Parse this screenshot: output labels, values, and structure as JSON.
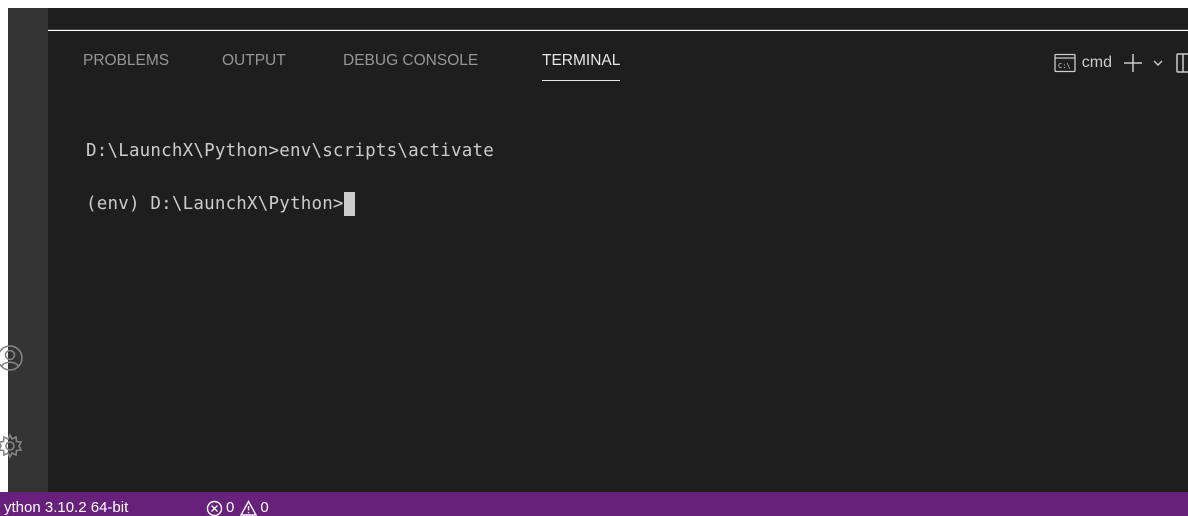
{
  "panel": {
    "tabs": [
      {
        "label": "PROBLEMS"
      },
      {
        "label": "OUTPUT"
      },
      {
        "label": "DEBUG CONSOLE"
      },
      {
        "label": "TERMINAL"
      }
    ],
    "active_tab": "TERMINAL",
    "terminal_name": "cmd"
  },
  "terminal": {
    "lines": [
      "D:\\LaunchX\\Python>env\\scripts\\activate",
      "(env) D:\\LaunchX\\Python>"
    ]
  },
  "status_bar": {
    "interpreter": "ython 3.10.2 64-bit",
    "errors": "0",
    "warnings": "0"
  },
  "colors": {
    "status_bar_bg": "#68217a",
    "panel_bg": "#1e1e1e",
    "tab_active": "#e7e7e7",
    "tab_inactive": "#969696"
  },
  "icons": [
    "account-icon",
    "manage-gear-icon",
    "terminal-shell-icon",
    "plus-icon",
    "chevron-down-icon",
    "split-terminal-icon",
    "error-circle-icon",
    "warning-triangle-icon"
  ]
}
